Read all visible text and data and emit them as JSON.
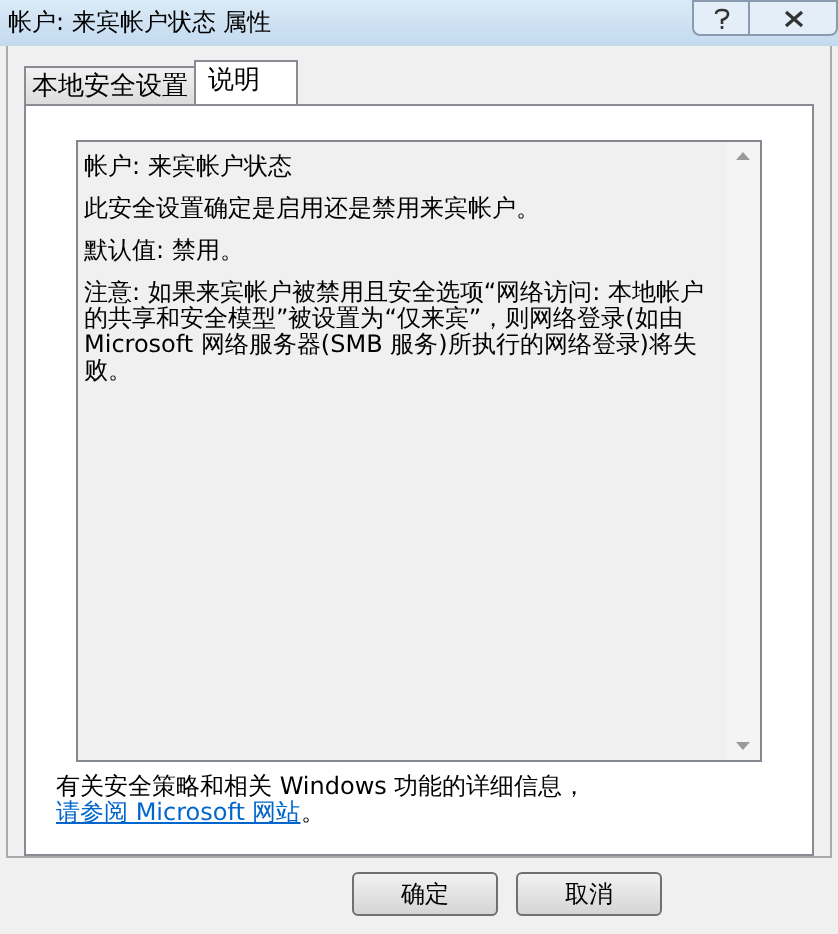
{
  "window": {
    "title": "帐户: 来宾帐户状态 属性"
  },
  "tabs": [
    {
      "label": "本地安全设置",
      "selected": false
    },
    {
      "label": "说明",
      "selected": true
    }
  ],
  "description": [
    "帐户: 来宾帐户状态",
    "此安全设置确定是启用还是禁用来宾帐户。",
    "默认值: 禁用。",
    "注意: 如果来宾帐户被禁用且安全选项“网络访问: 本地帐户的共享和安全模型”被设置为“仅来宾”，则网络登录(如由 Microsoft 网络服务器(SMB 服务)所执行的网络登录)将失败。"
  ],
  "info": {
    "text": "有关安全策略和相关 Windows 功能的详细信息，",
    "link": "请参阅 Microsoft 网站",
    "after": "。"
  },
  "buttons": [
    "确定",
    "取消"
  ]
}
